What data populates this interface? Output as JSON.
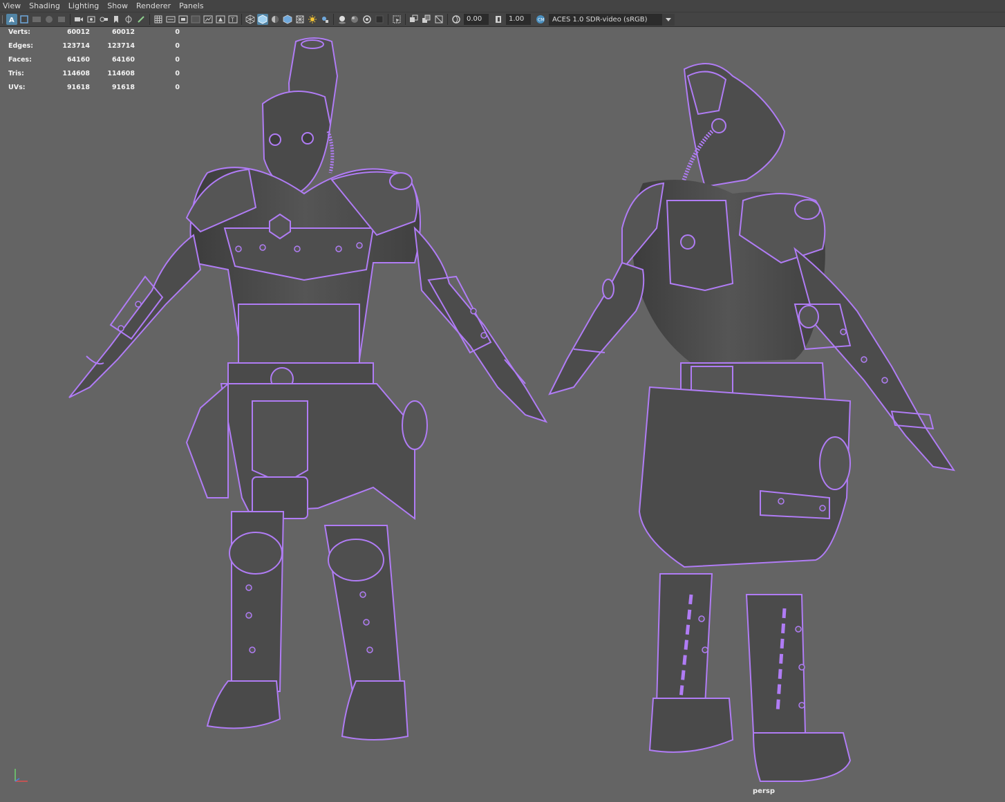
{
  "menu": [
    "View",
    "Shading",
    "Lighting",
    "Show",
    "Renderer",
    "Panels"
  ],
  "toolbar": {
    "icons_group1": [
      "select-camera-icon",
      "camera-attributes-icon",
      "bookmark-icon",
      "image-plane-icon",
      "2d-pan-zoom-icon"
    ],
    "icons_group2": [
      "camera-icon",
      "film-gate-icon",
      "grease-pencil-icon",
      "bookmark-flag-icon",
      "snap-icon",
      "pencil-icon"
    ],
    "icons_group3": [
      "grid-icon",
      "film-gate-toggle-icon",
      "resolution-gate-icon",
      "gate-mask-icon",
      "field-chart-icon",
      "safe-action-icon",
      "safe-title-icon"
    ],
    "icons_group4": [
      "wireframe-icon",
      "smooth-shade-icon",
      "default-material-icon",
      "textured-icon",
      "lights-icon",
      "shadows-icon"
    ],
    "icons_group5": [
      "ambient-occlusion-icon",
      "motion-blur-icon",
      "anti-alias-icon",
      "depth-of-field-icon"
    ],
    "icons_group6": [
      "isolate-select-icon",
      "xray-icon",
      "xray-joints-icon",
      "xray-components-icon"
    ],
    "exposure_value": "0.00",
    "gamma_value": "1.00",
    "color_management": "ACES 1.0 SDR-video (sRGB)"
  },
  "hud": {
    "rows": [
      {
        "label": "Verts:",
        "a": "60012",
        "b": "60012",
        "c": "0"
      },
      {
        "label": "Edges:",
        "a": "123714",
        "b": "123714",
        "c": "0"
      },
      {
        "label": "Faces:",
        "a": "64160",
        "b": "64160",
        "c": "0"
      },
      {
        "label": "Tris:",
        "a": "114608",
        "b": "114608",
        "c": "0"
      },
      {
        "label": "UVs:",
        "a": "91618",
        "b": "91618",
        "c": "0"
      }
    ]
  },
  "viewport": {
    "camera": "persp",
    "background": "#646464",
    "highlight_color": "#b07cf5",
    "mesh_color": "#4b4b4b"
  }
}
